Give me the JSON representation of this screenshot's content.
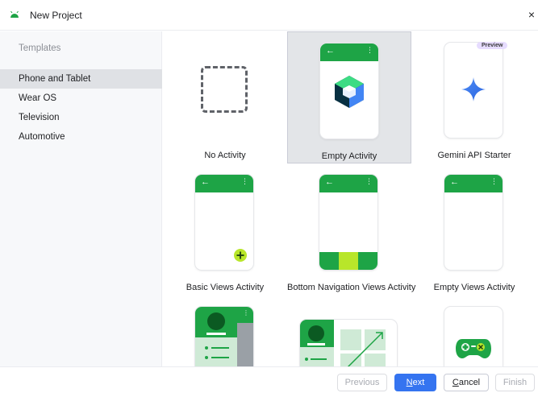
{
  "window": {
    "title": "New Project",
    "close_label": "×",
    "app_icon": "android-icon"
  },
  "sidebar": {
    "heading": "Templates",
    "items": [
      {
        "label": "Phone and Tablet",
        "selected": true
      },
      {
        "label": "Wear OS",
        "selected": false
      },
      {
        "label": "Television",
        "selected": false
      },
      {
        "label": "Automotive",
        "selected": false
      }
    ]
  },
  "templates": [
    {
      "label": "No Activity",
      "selected": false
    },
    {
      "label": "Empty Activity",
      "selected": true
    },
    {
      "label": "Gemini API Starter",
      "selected": false,
      "badge": "Preview"
    },
    {
      "label": "Basic Views Activity",
      "selected": false
    },
    {
      "label": "Bottom Navigation Views Activity",
      "selected": false
    },
    {
      "label": "Empty Views Activity",
      "selected": false
    }
  ],
  "buttons": {
    "previous": "Previous",
    "next": {
      "mnemonic": "N",
      "rest": "ext"
    },
    "cancel": {
      "mnemonic": "C",
      "rest": "ancel"
    },
    "finish": "Finish"
  },
  "phone_chrome": {
    "back_arrow": "←",
    "overflow_dots": "⋮"
  },
  "colors": {
    "brand_green": "#1ea446",
    "selection": "#dfe1e5",
    "primary_button": "#3574f0",
    "gemini_blue": "#3b7cf5"
  }
}
